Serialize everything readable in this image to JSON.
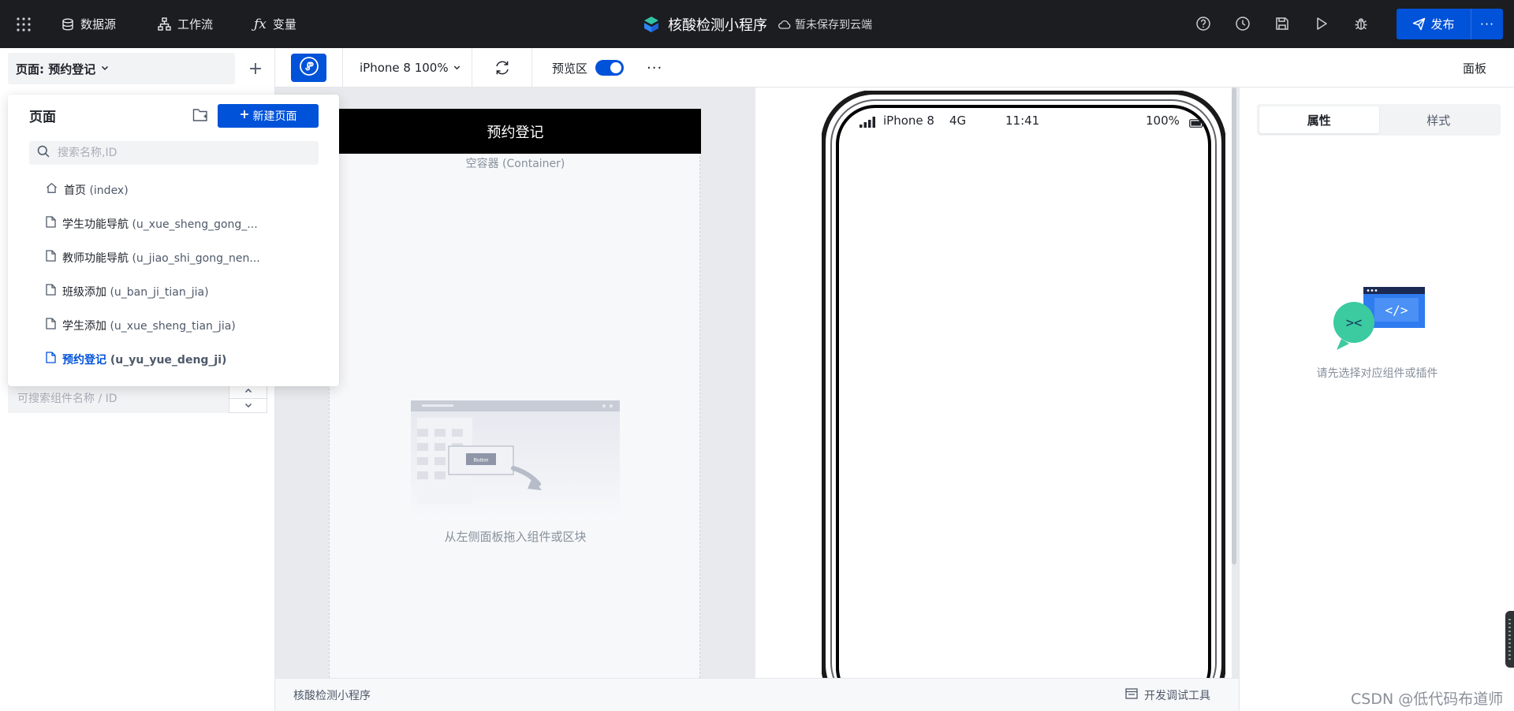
{
  "topbar": {
    "datasource_label": "数据源",
    "workflow_label": "工作流",
    "variable_label": "变量",
    "app_title": "核酸检测小程序",
    "save_status": "暂未保存到云端",
    "publish_label": "发布",
    "more_label": "···"
  },
  "left_panel": {
    "page_selector_label": "页面: 预约登记",
    "add_label": "+",
    "component_search_placeholder": "可搜索组件名称 / ID"
  },
  "pages_popover": {
    "title": "页面",
    "new_page_label": "新建页面",
    "search_placeholder": "搜索名称,ID",
    "pages": [
      {
        "name": "首页",
        "id": "(index)",
        "icon": "home-icon",
        "active": false
      },
      {
        "name": "学生功能导航",
        "id": "(u_xue_sheng_gong_...",
        "icon": "file-icon",
        "active": false
      },
      {
        "name": "教师功能导航",
        "id": "(u_jiao_shi_gong_nen...",
        "icon": "file-icon",
        "active": false
      },
      {
        "name": "班级添加",
        "id": "(u_ban_ji_tian_jia)",
        "icon": "file-icon",
        "active": false
      },
      {
        "name": "学生添加",
        "id": "(u_xue_sheng_tian_jia)",
        "icon": "file-icon",
        "active": false
      },
      {
        "name": "预约登记",
        "id": "(u_yu_yue_deng_ji)",
        "icon": "file-icon",
        "active": true
      }
    ]
  },
  "canvas_toolbar": {
    "device_label": "iPhone 8 100%",
    "preview_label": "预览区",
    "more_label": "···",
    "panel_label": "面板"
  },
  "editor": {
    "page_header_title": "预约登记",
    "container_label": "空容器 (Container)",
    "illustration_button_text": "Button",
    "empty_hint": "从左侧面板拖入组件或区块"
  },
  "phone": {
    "carrier": "iPhone 8",
    "network": "4G",
    "time": "11:41",
    "battery": "100%"
  },
  "right_panel": {
    "tab_properties": "属性",
    "tab_styles": "样式",
    "illustration_code_text": "</>",
    "illustration_bubble_text": "><",
    "empty_hint": "请先选择对应组件或插件"
  },
  "footer": {
    "app_name": "核酸检测小程序",
    "devtools_label": "开发调试工具"
  },
  "watermark": "CSDN @低代码布道师",
  "colors": {
    "topbar_bg": "#1b1d21",
    "primary": "#0052d9",
    "canvas_bg": "#e8eaed"
  }
}
